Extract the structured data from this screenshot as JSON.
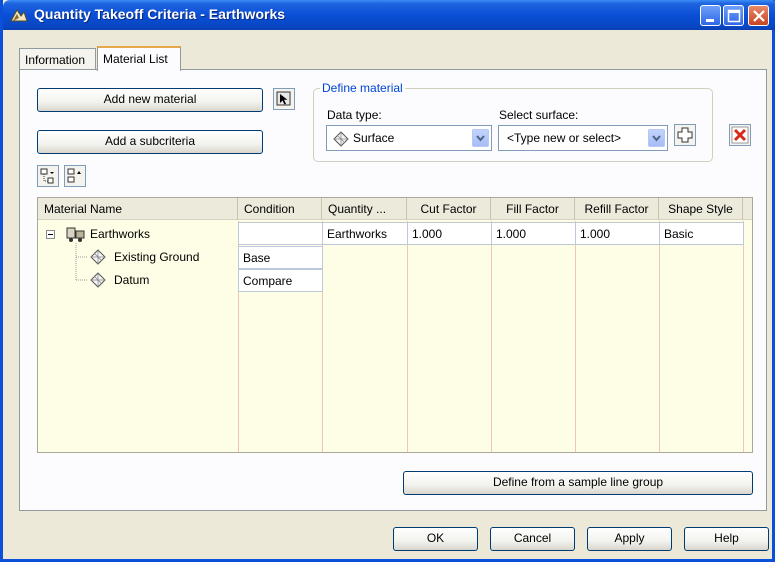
{
  "window": {
    "title": "Quantity Takeoff Criteria - Earthworks"
  },
  "tabs": [
    {
      "label": "Information"
    },
    {
      "label": "Material List"
    }
  ],
  "buttons": {
    "add_material": "Add new material",
    "add_subcriteria": "Add a subcriteria",
    "define_sample": "Define from a sample line group",
    "ok": "OK",
    "cancel": "Cancel",
    "apply": "Apply",
    "help": "Help"
  },
  "define_material": {
    "legend": "Define material",
    "data_type_label": "Data type:",
    "data_type_value": "Surface",
    "surface_label": "Select surface:",
    "surface_value": "<Type new or select>"
  },
  "table": {
    "columns": [
      "Material Name",
      "Condition",
      "Quantity ...",
      "Cut Factor",
      "Fill Factor",
      "Refill Factor",
      "Shape Style"
    ],
    "rows": [
      {
        "name": "Earthworks",
        "condition": "",
        "quantity": "Earthworks",
        "cut": "1.000",
        "fill": "1.000",
        "refill": "1.000",
        "shape": "Basic"
      },
      {
        "name": "Existing Ground",
        "condition": "Base"
      },
      {
        "name": "Datum",
        "condition": "Compare"
      }
    ]
  },
  "icons": {
    "title": "civil3d-app-icon",
    "pick": "pick-from-drawing-icon",
    "expand": "expand-all-icon",
    "collapse": "collapse-all-icon",
    "add_surface": "add-surface-icon",
    "delete": "delete-icon",
    "surface": "surface-icon",
    "material": "material-icon"
  },
  "colors": {
    "title_bar": "#0a4fd6",
    "tab_highlight": "#e6a84a",
    "legend_text": "#0046d5",
    "table_bg": "#fefee6",
    "delete_red": "#d62a1a"
  }
}
